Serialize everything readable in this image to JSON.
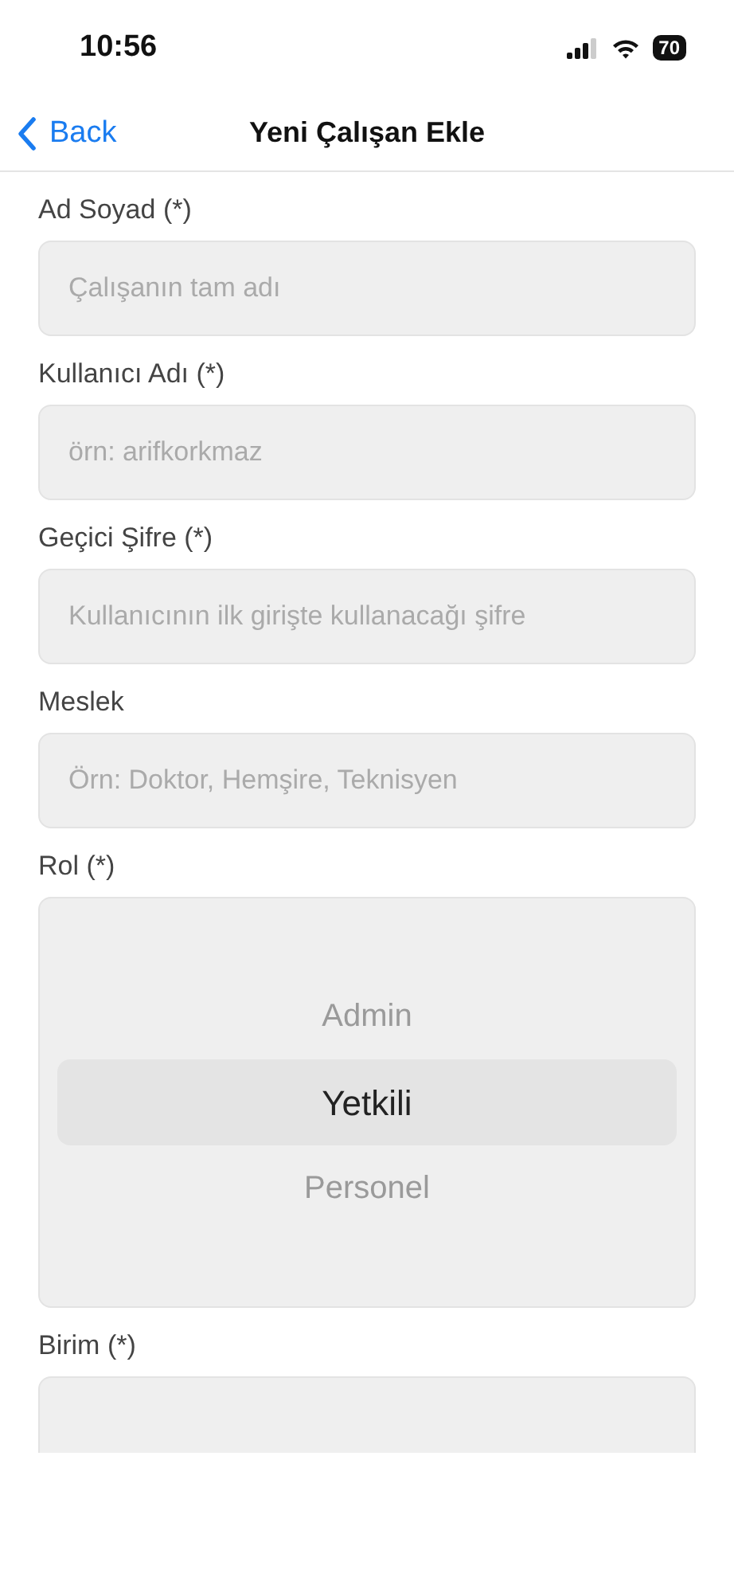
{
  "status_bar": {
    "time": "10:56",
    "battery": "70"
  },
  "nav": {
    "back": "Back",
    "title": "Yeni Çalışan Ekle"
  },
  "fields": [
    {
      "kind": "text",
      "label": "Ad Soyad (*)",
      "placeholder": "Çalışanın tam adı"
    },
    {
      "kind": "text",
      "label": "Kullanıcı Adı (*)",
      "placeholder": "örn: arifkorkmaz"
    },
    {
      "kind": "text",
      "label": "Geçici Şifre (*)",
      "placeholder": "Kullanıcının ilk girişte kullanacağı şifre"
    },
    {
      "kind": "text",
      "label": "Meslek",
      "placeholder": "Örn: Doktor, Hemşire, Teknisyen"
    },
    {
      "kind": "picker",
      "label": "Rol (*)",
      "options": [
        {
          "label": "Admin",
          "selected": false
        },
        {
          "label": "Yetkili",
          "selected": true
        },
        {
          "label": "Personel",
          "selected": false
        }
      ]
    },
    {
      "kind": "cut",
      "label": "Birim (*)"
    }
  ]
}
